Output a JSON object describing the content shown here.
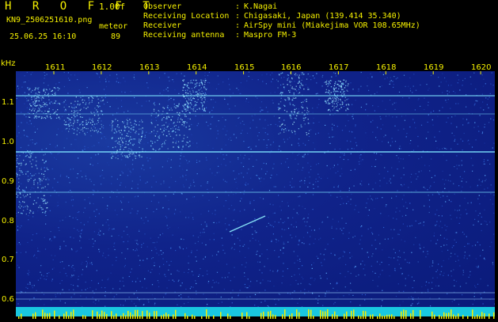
{
  "header": {
    "brand": "H R O F F T",
    "version": "1.00f",
    "filename": "KN9_2506251610.png",
    "meteor_label": "meteor",
    "datetime": "25.06.25 16:10",
    "meteor_count": "89",
    "info": [
      {
        "label": "Observer",
        "value": "K.Nagai"
      },
      {
        "label": "Receiving Location",
        "value": "Chigasaki, Japan (139.414 35.340)"
      },
      {
        "label": "Receiver",
        "value": "AirSpy mini (Miakejima VOR 108.65MHz)"
      },
      {
        "label": "Receiving antenna",
        "value": "Maspro FM-3"
      }
    ],
    "separator": ":"
  },
  "axes": {
    "y_unit": "kHz",
    "y_ticks": [
      "1.1",
      "1.0",
      "0.9",
      "0.8",
      "0.7",
      "0.6"
    ],
    "x_ticks": [
      "1611",
      "1612",
      "1613",
      "1614",
      "1615",
      "1616",
      "1617",
      "1618",
      "1619",
      "1620"
    ]
  },
  "colors": {
    "text": "#f5f000",
    "background": "#0a1a7a",
    "carrier_lines": "#7fe6ff",
    "bottom_bar": "#19c7e0"
  }
}
